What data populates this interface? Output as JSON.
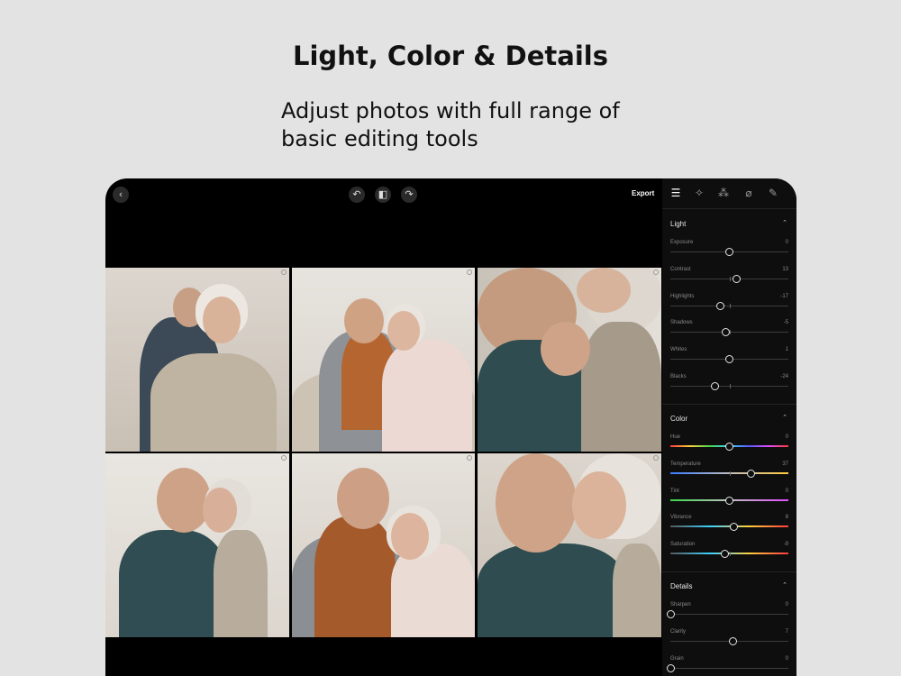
{
  "header": {
    "title": "Light, Color & Details",
    "subtitle": "Adjust photos with full range of basic editing tools"
  },
  "toolbar": {
    "back_icon": "chevron-left-icon",
    "undo_icon": "undo-icon",
    "compare_icon": "compare-icon",
    "redo_icon": "redo-icon",
    "export_label": "Export"
  },
  "panel_tabs": [
    "sliders-icon",
    "sparkle-icon",
    "color-mix-icon",
    "bandage-icon",
    "brush-icon"
  ],
  "sections": {
    "light": {
      "title": "Light",
      "sliders": [
        {
          "label": "Exposure",
          "value": "0",
          "position": 0.5
        },
        {
          "label": "Contrast",
          "value": "13",
          "position": 0.56
        },
        {
          "label": "Highlights",
          "value": "-17",
          "position": 0.42
        },
        {
          "label": "Shadows",
          "value": "-5",
          "position": 0.47
        },
        {
          "label": "Whites",
          "value": "1",
          "position": 0.5
        },
        {
          "label": "Blacks",
          "value": "-24",
          "position": 0.38
        }
      ]
    },
    "color": {
      "title": "Color",
      "sliders": [
        {
          "label": "Hue",
          "value": "0",
          "position": 0.5
        },
        {
          "label": "Temperature",
          "value": "37",
          "position": 0.68
        },
        {
          "label": "Tint",
          "value": "0",
          "position": 0.5
        },
        {
          "label": "Vibrance",
          "value": "8",
          "position": 0.54
        },
        {
          "label": "Saturation",
          "value": "-9",
          "position": 0.46
        }
      ]
    },
    "details": {
      "title": "Details",
      "sliders": [
        {
          "label": "Sharpen",
          "value": "0",
          "position": 0.0
        },
        {
          "label": "Clarity",
          "value": "7",
          "position": 0.53
        },
        {
          "label": "Grain",
          "value": "0",
          "position": 0.0
        }
      ]
    }
  },
  "colors": {
    "background": "#e3e3e3",
    "device": "#000000",
    "panel": "#0e0e0e",
    "knob": "#e6e6e6"
  }
}
